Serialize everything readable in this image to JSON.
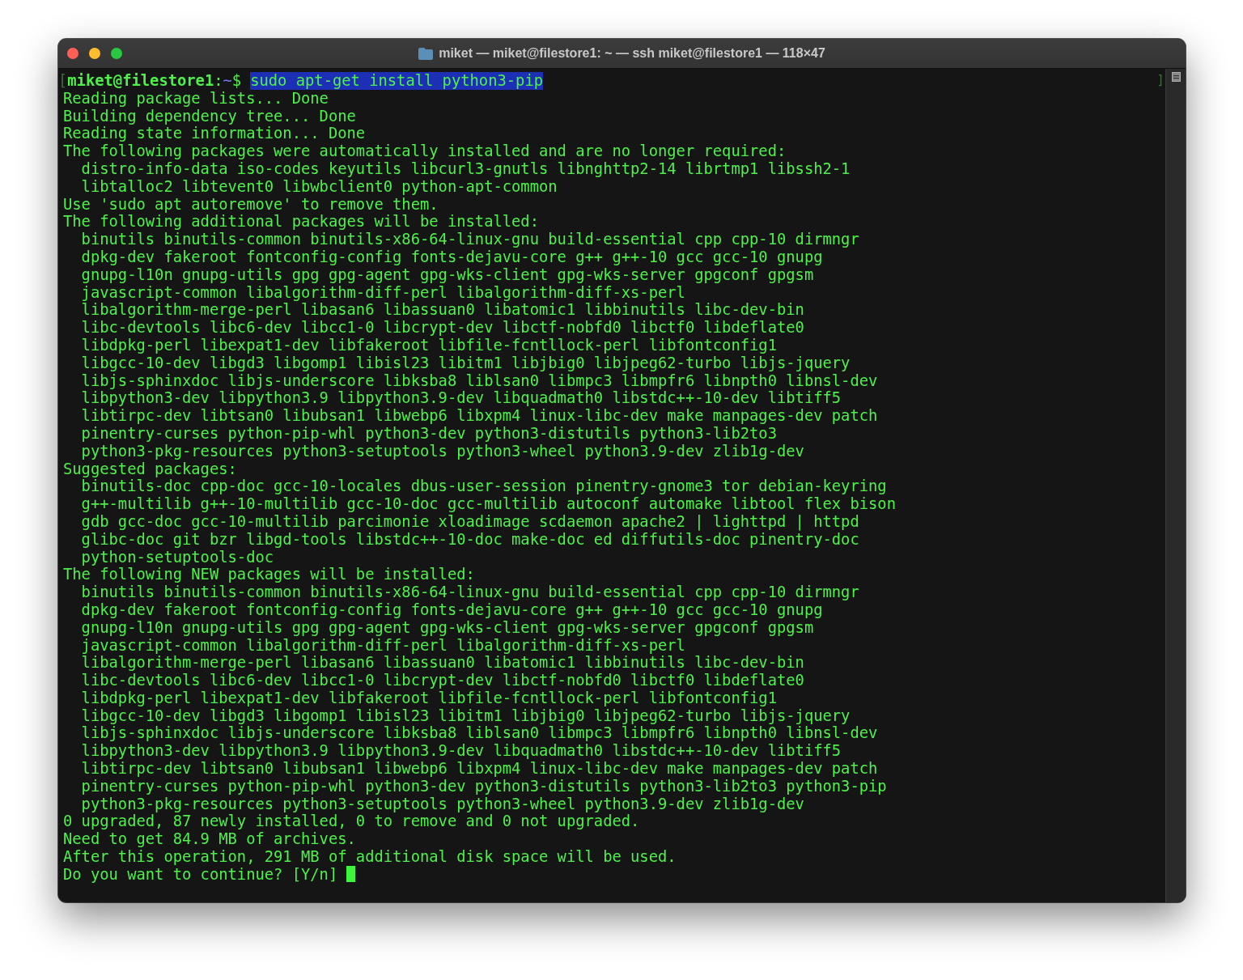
{
  "window": {
    "title": "miket — miket@filestore1: ~ — ssh miket@filestore1 — 118×47"
  },
  "marks": {
    "start": "[",
    "end": "]"
  },
  "prompt": {
    "user_host": "miket@filestore1",
    "separator": ":",
    "path": "~",
    "symbol": "$",
    "command": "sudo apt-get install python3-pip",
    "command_selected": true
  },
  "output_lines": [
    "Reading package lists... Done",
    "Building dependency tree... Done",
    "Reading state information... Done",
    "The following packages were automatically installed and are no longer required:",
    "  distro-info-data iso-codes keyutils libcurl3-gnutls libnghttp2-14 librtmp1 libssh2-1",
    "  libtalloc2 libtevent0 libwbclient0 python-apt-common",
    "Use 'sudo apt autoremove' to remove them.",
    "The following additional packages will be installed:",
    "  binutils binutils-common binutils-x86-64-linux-gnu build-essential cpp cpp-10 dirmngr",
    "  dpkg-dev fakeroot fontconfig-config fonts-dejavu-core g++ g++-10 gcc gcc-10 gnupg",
    "  gnupg-l10n gnupg-utils gpg gpg-agent gpg-wks-client gpg-wks-server gpgconf gpgsm",
    "  javascript-common libalgorithm-diff-perl libalgorithm-diff-xs-perl",
    "  libalgorithm-merge-perl libasan6 libassuan0 libatomic1 libbinutils libc-dev-bin",
    "  libc-devtools libc6-dev libcc1-0 libcrypt-dev libctf-nobfd0 libctf0 libdeflate0",
    "  libdpkg-perl libexpat1-dev libfakeroot libfile-fcntllock-perl libfontconfig1",
    "  libgcc-10-dev libgd3 libgomp1 libisl23 libitm1 libjbig0 libjpeg62-turbo libjs-jquery",
    "  libjs-sphinxdoc libjs-underscore libksba8 liblsan0 libmpc3 libmpfr6 libnpth0 libnsl-dev",
    "  libpython3-dev libpython3.9 libpython3.9-dev libquadmath0 libstdc++-10-dev libtiff5",
    "  libtirpc-dev libtsan0 libubsan1 libwebp6 libxpm4 linux-libc-dev make manpages-dev patch",
    "  pinentry-curses python-pip-whl python3-dev python3-distutils python3-lib2to3",
    "  python3-pkg-resources python3-setuptools python3-wheel python3.9-dev zlib1g-dev",
    "Suggested packages:",
    "  binutils-doc cpp-doc gcc-10-locales dbus-user-session pinentry-gnome3 tor debian-keyring",
    "  g++-multilib g++-10-multilib gcc-10-doc gcc-multilib autoconf automake libtool flex bison",
    "  gdb gcc-doc gcc-10-multilib parcimonie xloadimage scdaemon apache2 | lighttpd | httpd",
    "  glibc-doc git bzr libgd-tools libstdc++-10-doc make-doc ed diffutils-doc pinentry-doc",
    "  python-setuptools-doc",
    "The following NEW packages will be installed:",
    "  binutils binutils-common binutils-x86-64-linux-gnu build-essential cpp cpp-10 dirmngr",
    "  dpkg-dev fakeroot fontconfig-config fonts-dejavu-core g++ g++-10 gcc gcc-10 gnupg",
    "  gnupg-l10n gnupg-utils gpg gpg-agent gpg-wks-client gpg-wks-server gpgconf gpgsm",
    "  javascript-common libalgorithm-diff-perl libalgorithm-diff-xs-perl",
    "  libalgorithm-merge-perl libasan6 libassuan0 libatomic1 libbinutils libc-dev-bin",
    "  libc-devtools libc6-dev libcc1-0 libcrypt-dev libctf-nobfd0 libctf0 libdeflate0",
    "  libdpkg-perl libexpat1-dev libfakeroot libfile-fcntllock-perl libfontconfig1",
    "  libgcc-10-dev libgd3 libgomp1 libisl23 libitm1 libjbig0 libjpeg62-turbo libjs-jquery",
    "  libjs-sphinxdoc libjs-underscore libksba8 liblsan0 libmpc3 libmpfr6 libnpth0 libnsl-dev",
    "  libpython3-dev libpython3.9 libpython3.9-dev libquadmath0 libstdc++-10-dev libtiff5",
    "  libtirpc-dev libtsan0 libubsan1 libwebp6 libxpm4 linux-libc-dev make manpages-dev patch",
    "  pinentry-curses python-pip-whl python3-dev python3-distutils python3-lib2to3 python3-pip",
    "  python3-pkg-resources python3-setuptools python3-wheel python3.9-dev zlib1g-dev",
    "0 upgraded, 87 newly installed, 0 to remove and 0 not upgraded.",
    "Need to get 84.9 MB of archives.",
    "After this operation, 291 MB of additional disk space will be used."
  ],
  "final_prompt": {
    "text": "Do you want to continue? [Y/n]",
    "cursor_visible": true
  }
}
